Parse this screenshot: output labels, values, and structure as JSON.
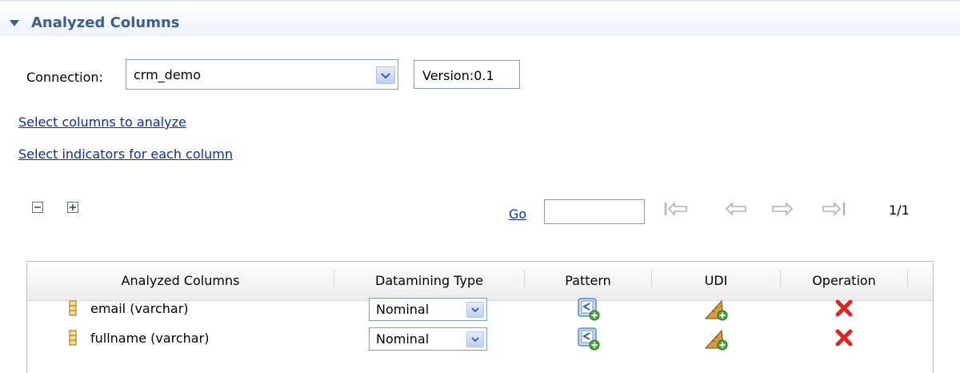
{
  "section": {
    "title": "Analyzed Columns",
    "toggle_icon": "triangle-down-icon"
  },
  "connection": {
    "label": "Connection:",
    "value": "crm_demo",
    "dropdown_icon": "chevron-down-icon",
    "version_label": "Version:0.1"
  },
  "links": {
    "select_columns": "Select columns to analyze",
    "select_indicators": "Select indicators for each column"
  },
  "toolbar": {
    "collapse_icon": "collapse-all-icon",
    "expand_icon": "expand-all-icon"
  },
  "pagination": {
    "go_label": "Go",
    "page_input_value": "",
    "first_icon": "first-page-icon",
    "prev_icon": "previous-page-icon",
    "next_icon": "next-page-icon",
    "last_icon": "last-page-icon",
    "page_count": "1/1"
  },
  "table": {
    "headers": [
      "Analyzed Columns",
      "Datamining Type",
      "Pattern",
      "UDI",
      "Operation"
    ],
    "rows": [
      {
        "column": "email (varchar)",
        "datamining_type": "Nominal",
        "pattern_icon": "add-pattern-icon",
        "udi_icon": "add-udi-icon",
        "operation_icon": "delete-icon"
      },
      {
        "column": "fullname (varchar)",
        "datamining_type": "Nominal",
        "pattern_icon": "add-pattern-icon",
        "udi_icon": "add-udi-icon",
        "operation_icon": "delete-icon"
      }
    ]
  },
  "colors": {
    "section_title": "#3a5f8f",
    "link": "#0a2ea8",
    "delete": "#e0261c"
  }
}
